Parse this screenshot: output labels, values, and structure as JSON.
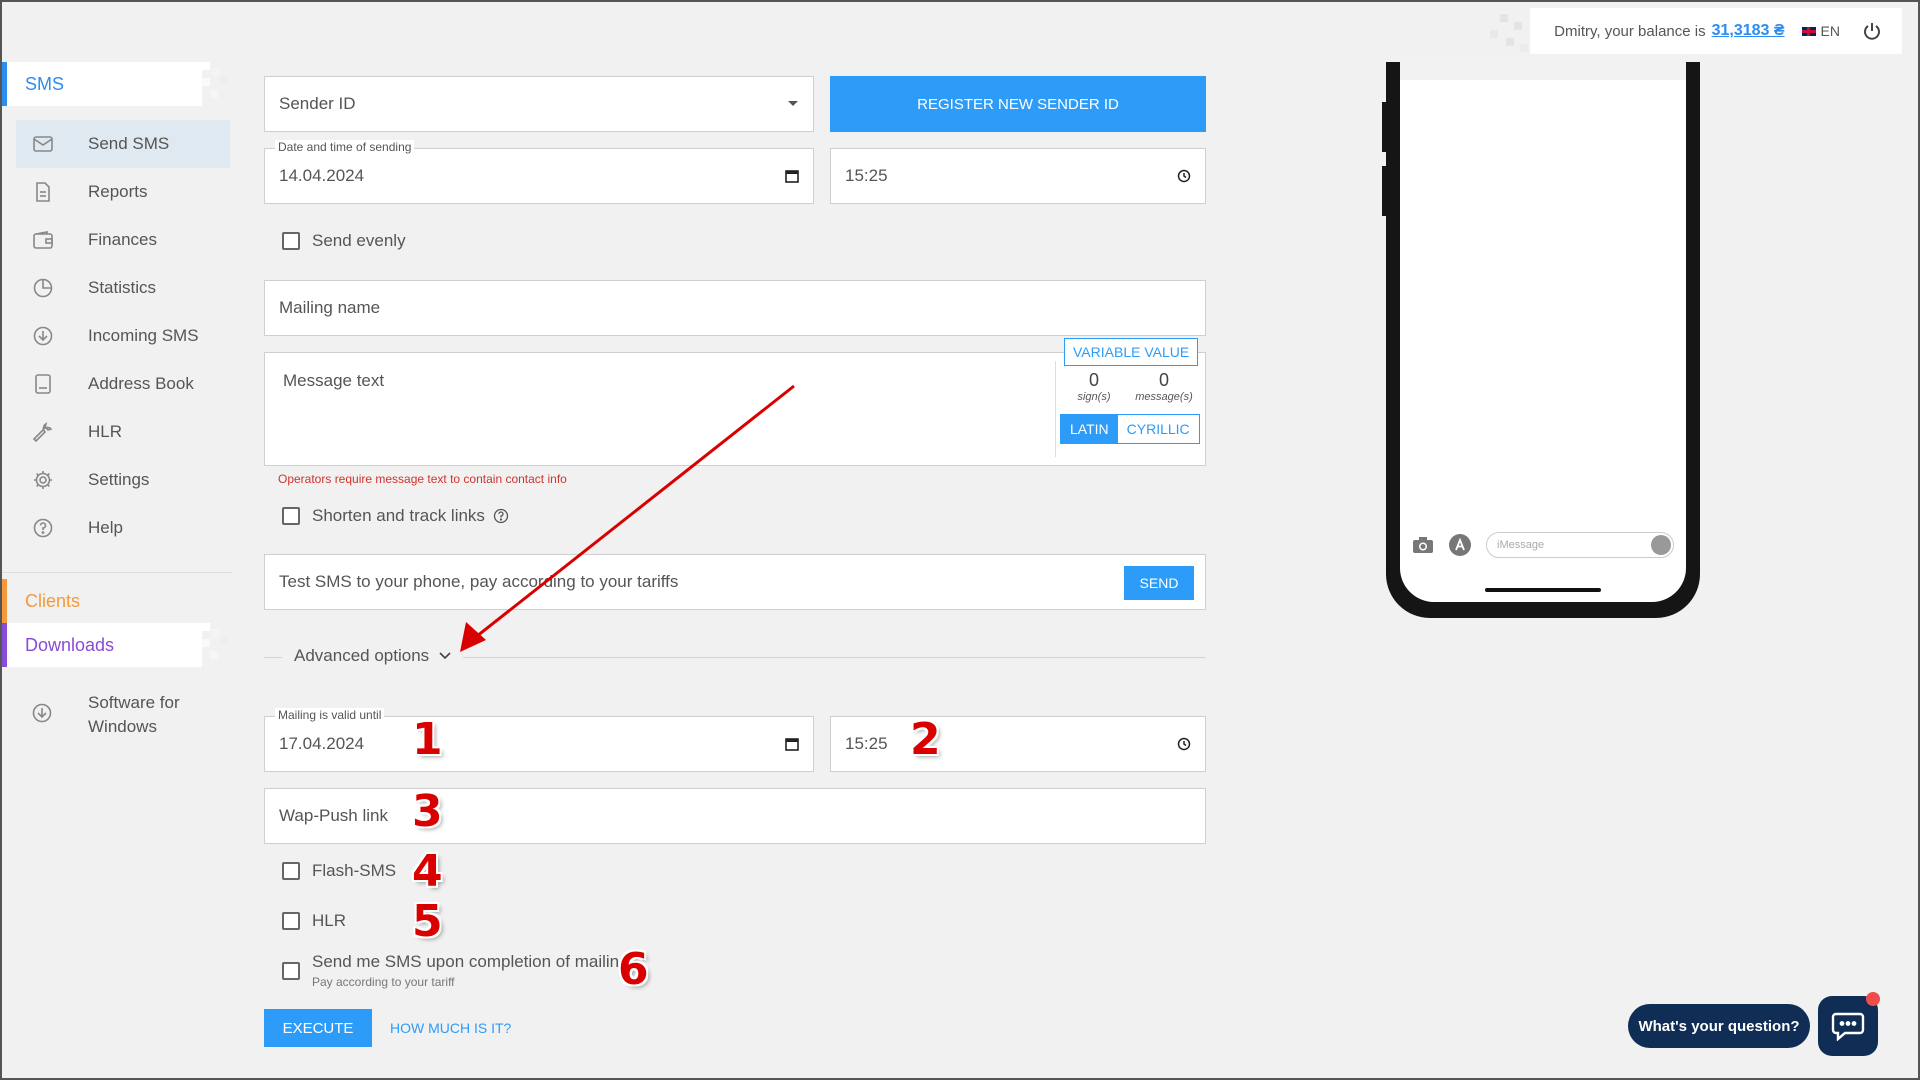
{
  "header": {
    "greeting": "Dmitry, your balance is",
    "balance": "31,3183 ₴",
    "lang": "EN"
  },
  "sidebar": {
    "section_sms": "SMS",
    "items": [
      {
        "label": "Send SMS",
        "icon": "envelope-icon"
      },
      {
        "label": "Reports",
        "icon": "document-icon"
      },
      {
        "label": "Finances",
        "icon": "wallet-icon"
      },
      {
        "label": "Statistics",
        "icon": "pie-chart-icon"
      },
      {
        "label": "Incoming SMS",
        "icon": "download-circle-icon"
      },
      {
        "label": "Address Book",
        "icon": "book-icon"
      },
      {
        "label": "HLR",
        "icon": "wrench-icon"
      },
      {
        "label": "Settings",
        "icon": "gear-icon"
      },
      {
        "label": "Help",
        "icon": "question-icon"
      }
    ],
    "section_clients": "Clients",
    "section_downloads": "Downloads",
    "software_line1": "Software for",
    "software_line2": "Windows"
  },
  "form": {
    "sender_placeholder": "Sender ID",
    "register_btn": "REGISTER NEW SENDER ID",
    "date_legend": "Date and time of sending",
    "date_value": "14.04.2024",
    "time_value": "15:25",
    "send_evenly": "Send evenly",
    "mailing_name": "Mailing name",
    "message_text": "Message text",
    "variable_btn": "VARIABLE VALUE",
    "signs_count": "0",
    "signs_label": "sign(s)",
    "messages_count": "0",
    "messages_label": "message(s)",
    "latin": "LATIN",
    "cyrillic": "CYRILLIC",
    "operators_note": "Operators require message text to contain contact info",
    "shorten_links": "Shorten and track links",
    "test_sms_placeholder": "Test SMS to your phone, pay according to your tariffs",
    "send_btn": "SEND",
    "advanced_options": "Advanced options",
    "valid_legend": "Mailing is valid until",
    "valid_date": "17.04.2024",
    "valid_time": "15:25",
    "wap_push": "Wap-Push link",
    "flash_sms": "Flash-SMS",
    "hlr": "HLR",
    "completion_sms": "Send me SMS upon completion of mailing",
    "completion_sub": "Pay according to your tariff",
    "execute_btn": "EXECUTE",
    "how_much": "HOW MUCH IS IT?"
  },
  "annotations": {
    "n1": "1",
    "n2": "2",
    "n3": "3",
    "n4": "4",
    "n5": "5",
    "n6": "6"
  },
  "phone": {
    "imessage_placeholder": "iMessage"
  },
  "chat": {
    "question": "What's your question?"
  },
  "colors": {
    "accent": "#2d9cf8",
    "clients": "#f39a3a",
    "downloads": "#8a4bd6",
    "annotation": "#d90000",
    "chat": "#0f2d55"
  }
}
